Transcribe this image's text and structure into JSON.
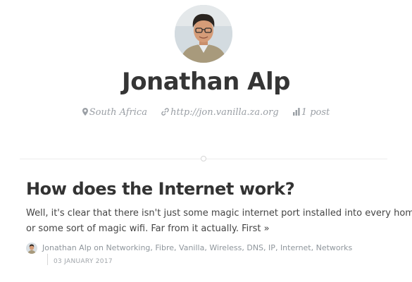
{
  "profile": {
    "name": "Jonathan Alp",
    "location": "South Africa",
    "website": "http://jon.vanilla.za.org",
    "post_count": "1 post"
  },
  "icons": {
    "location": "map-pin-icon",
    "website": "link-icon",
    "posts": "bar-chart-icon"
  },
  "post": {
    "title": "How does the Internet work?",
    "excerpt_line1": "Well, it's clear that there isn't just some magic internet port installed into every home,",
    "excerpt_line2": "or some sort of magic wifi. Far from it actually. First",
    "read_more": "»",
    "author": "Jonathan Alp",
    "on": "on",
    "tags": [
      "Networking",
      "Fibre",
      "Vanilla",
      "Wireless",
      "DNS",
      "IP",
      "Internet",
      "Networks"
    ],
    "date": "03 JANUARY 2017"
  },
  "colors": {
    "title": "#353535",
    "meta": "#9a9fa5",
    "text": "#444444",
    "divider": "#ececec"
  }
}
